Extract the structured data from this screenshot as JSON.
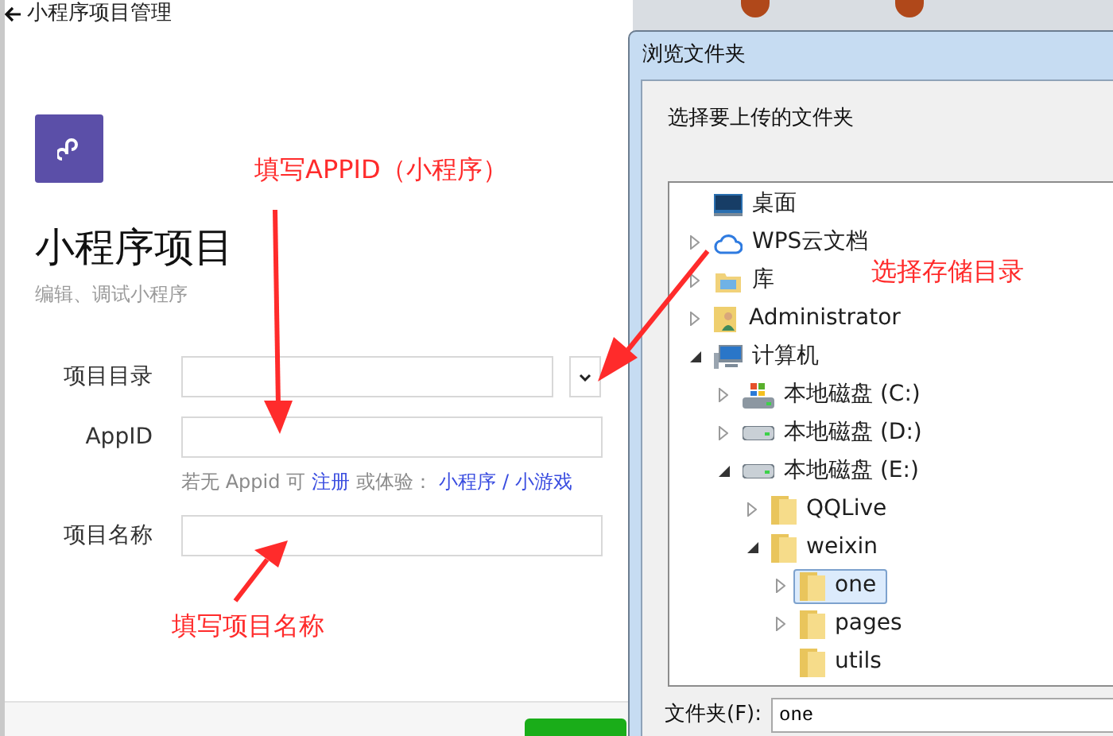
{
  "window": {
    "title": "小程序项目管理"
  },
  "project": {
    "title": "小程序项目",
    "subtitle": "编辑、调试小程序"
  },
  "form": {
    "fields": [
      {
        "kind": "directory",
        "label": "项目目录"
      },
      {
        "kind": "text",
        "label": "AppID"
      },
      {
        "kind": "text",
        "label": "项目名称"
      }
    ],
    "hint": {
      "prefix": "若无 Appid 可",
      "register": "注册",
      "middle": "或体验：",
      "mini_program": "小程序",
      "separator": "/",
      "mini_game": "小游戏"
    }
  },
  "dialog": {
    "title": "浏览文件夹",
    "prompt": "选择要上传的文件夹",
    "folder_label": "文件夹(F):",
    "folder_value": "one",
    "tree": [
      {
        "label": "桌面",
        "kind": "desktop",
        "expandable": false,
        "selected": false
      },
      {
        "label": "WPS云文档",
        "kind": "cloud",
        "expandable": true,
        "selected": false
      },
      {
        "label": "库",
        "kind": "library",
        "expandable": true,
        "selected": false
      },
      {
        "label": "Administrator",
        "kind": "user",
        "expandable": true,
        "selected": false
      },
      {
        "label": "计算机",
        "kind": "computer",
        "expandable": true,
        "expanded": true,
        "selected": false,
        "children": [
          {
            "label": "本地磁盘 (C:)",
            "kind": "system-drive",
            "expandable": true,
            "selected": false
          },
          {
            "label": "本地磁盘 (D:)",
            "kind": "drive",
            "expandable": true,
            "selected": false
          },
          {
            "label": "本地磁盘 (E:)",
            "kind": "drive",
            "expandable": true,
            "expanded": true,
            "selected": false,
            "children": [
              {
                "label": "QQLive",
                "kind": "folder",
                "expandable": true,
                "selected": false
              },
              {
                "label": "weixin",
                "kind": "folder",
                "expandable": true,
                "expanded": true,
                "selected": false,
                "children": [
                  {
                    "label": "one",
                    "kind": "folder",
                    "expandable": true,
                    "selected": true
                  },
                  {
                    "label": "pages",
                    "kind": "folder",
                    "expandable": true,
                    "selected": false
                  },
                  {
                    "label": "utils",
                    "kind": "folder",
                    "expandable": false,
                    "selected": false
                  }
                ]
              }
            ]
          }
        ]
      }
    ]
  },
  "annotations": [
    {
      "text": "填写APPID（小程序）"
    },
    {
      "text": "选择存储目录"
    },
    {
      "text": "填写项目名称"
    }
  ]
}
